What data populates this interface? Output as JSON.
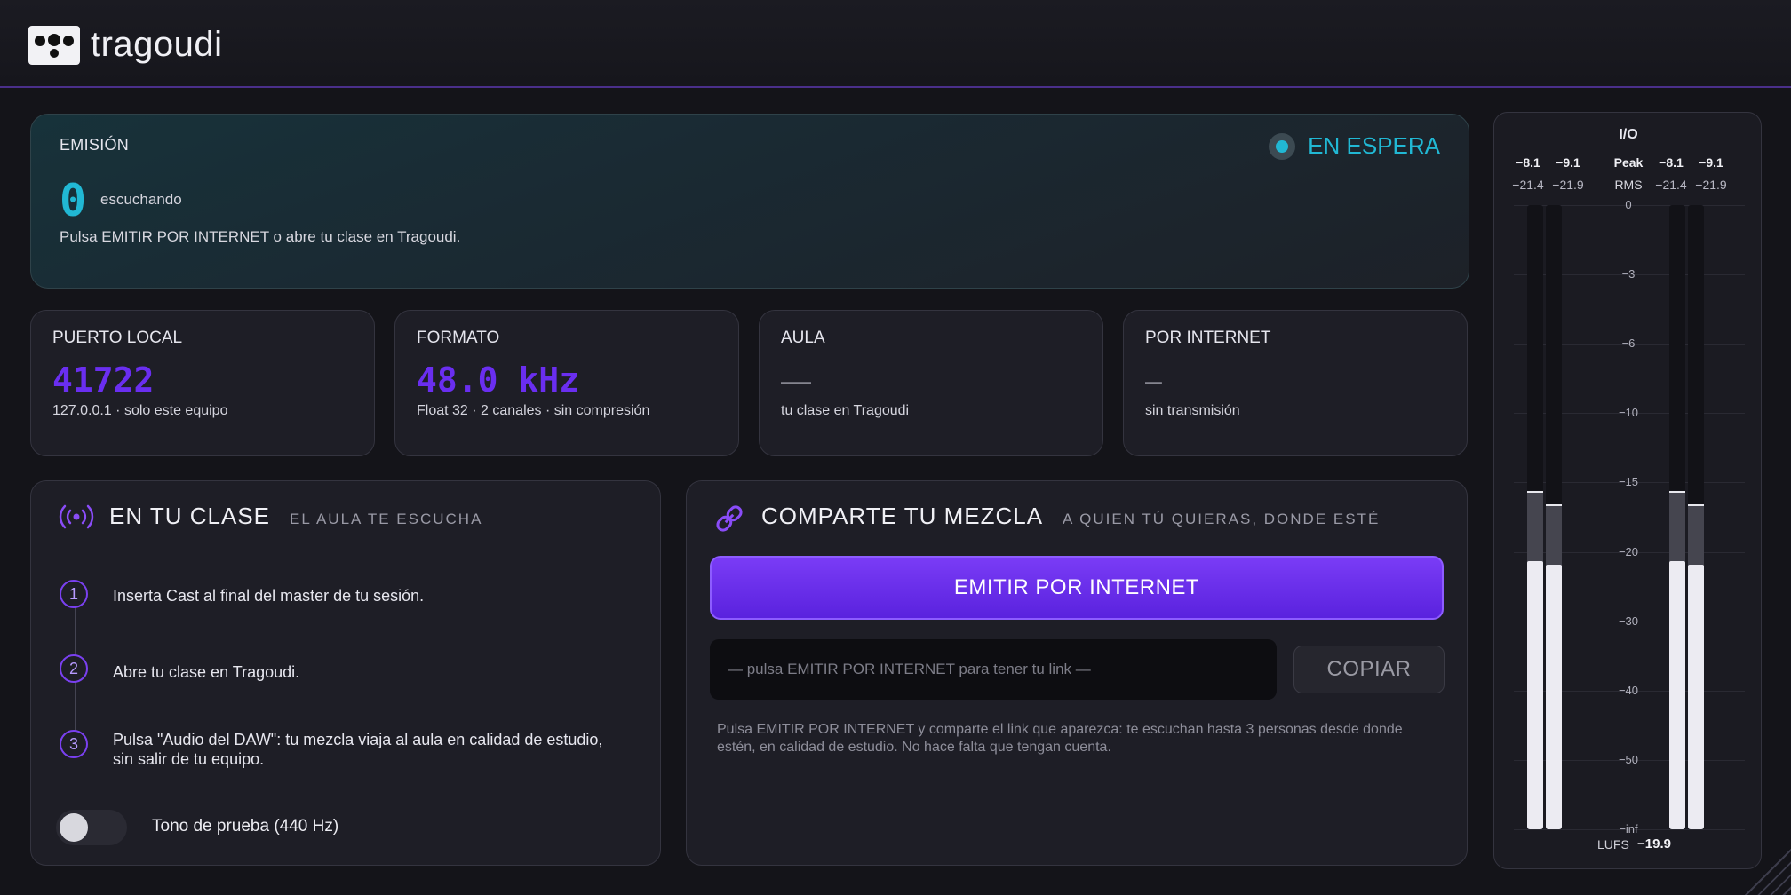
{
  "app": {
    "name": "tragoudi"
  },
  "emission": {
    "label": "EMISIÓN",
    "count": "0",
    "count_label": "escuchando",
    "hint": "Pulsa EMITIR POR INTERNET o abre tu clase en Tragoudi.",
    "status": "EN ESPERA",
    "status_color": "#21b8d4"
  },
  "stats": [
    {
      "title": "PUERTO LOCAL",
      "value": "41722",
      "sub": "127.0.0.1 · solo este equipo"
    },
    {
      "title": "FORMATO",
      "value": "48.0 kHz",
      "sub": "Float 32 · 2 canales · sin compresión"
    },
    {
      "title": "AULA",
      "value": "—",
      "sub": "tu clase en Tragoudi"
    },
    {
      "title": "POR INTERNET",
      "value": "–",
      "sub": "sin transmisión"
    }
  ],
  "class_section": {
    "title": "EN TU CLASE",
    "subtitle": "EL AULA TE ESCUCHA",
    "steps": [
      {
        "num": "1",
        "text": "Inserta Cast al final del master de tu sesión."
      },
      {
        "num": "2",
        "text": "Abre tu clase en Tragoudi."
      },
      {
        "num": "3",
        "text": "Pulsa \"Audio del DAW\": tu mezcla viaja al aula en calidad de estudio, sin salir de tu equipo."
      }
    ],
    "toggle_label": "Tono de prueba (440 Hz)",
    "toggle_on": false
  },
  "share_section": {
    "title": "COMPARTE TU MEZCLA",
    "subtitle": "A QUIEN TÚ QUIERAS, DONDE ESTÉ",
    "emit_button": "EMITIR POR INTERNET",
    "link_placeholder": "— pulsa EMITIR POR INTERNET para tener tu link —",
    "copy_button": "COPIAR",
    "note": "Pulsa EMITIR POR INTERNET y comparte el link que aparezca: te escuchan hasta 3 personas desde donde estén, en calidad de estudio. No hace falta que tengan cuenta."
  },
  "meters": {
    "title": "I/O",
    "peak_label": "Peak",
    "rms_label": "RMS",
    "input": {
      "peak": [
        "−8.1",
        "−9.1"
      ],
      "rms": [
        "−21.4",
        "−21.9"
      ]
    },
    "output": {
      "peak": [
        "−8.1",
        "−9.1"
      ],
      "rms": [
        "−21.4",
        "−21.9"
      ]
    },
    "scale": [
      "0",
      "−3",
      "−6",
      "−10",
      "−15",
      "−20",
      "−30",
      "−40",
      "−50",
      "−inf"
    ],
    "lufs_label": "LUFS",
    "lufs_value": "−19.9",
    "peak_hold_db": [
      -15.6,
      -16.6
    ],
    "rms_db": [
      -21.4,
      -21.9
    ]
  },
  "colors": {
    "accent": "#6a2ef0",
    "status": "#21b8d4",
    "background": "#141419"
  }
}
